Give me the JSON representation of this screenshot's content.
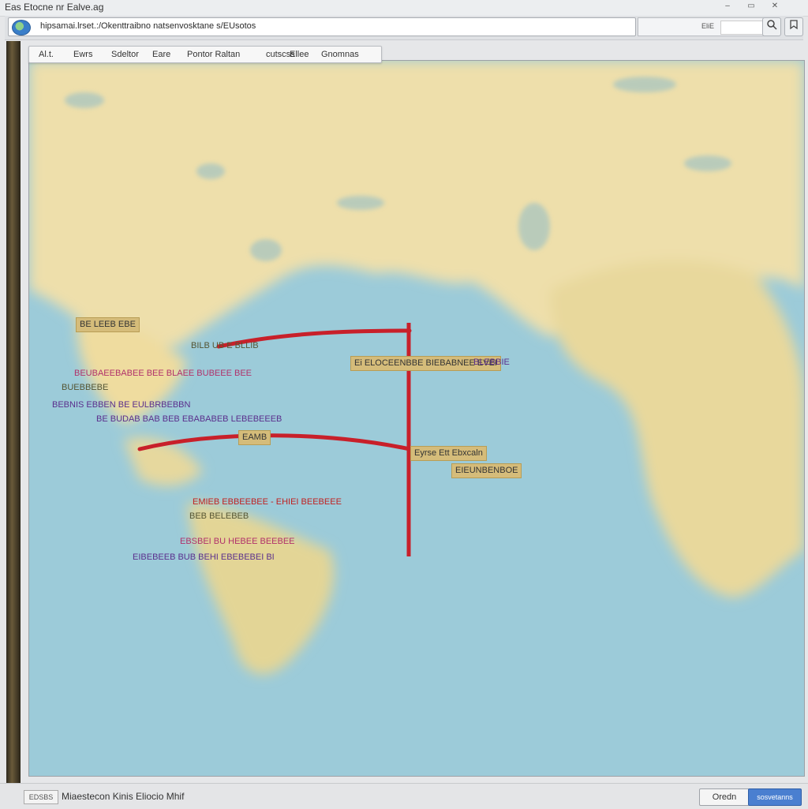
{
  "window": {
    "title": "Eas Etocne nr Ealve.ag",
    "controls": [
      "–",
      "▭",
      "✕"
    ]
  },
  "address": {
    "url": "hipsamai.lrset.:/Okenttraibno natsenvosktane s/EUsotos",
    "search_label": "EliE",
    "search_placeholder": "",
    "icons": [
      "globe-icon",
      "search-icon",
      "bookmark-icon"
    ]
  },
  "toolbar": {
    "items": [
      "Al.t.",
      "Ewrs",
      "Sdeltor",
      "Eare",
      "Pontor Raltan",
      "cutscss",
      "Ellee",
      "Gnomnas"
    ]
  },
  "map": {
    "colors": {
      "ocean": "#9ccbd9",
      "land": "#ead9a4",
      "route": "#c8202a"
    },
    "labels": [
      {
        "text": "BE LEEB EBE",
        "style": "tan"
      },
      {
        "text": "BILB UB E BLLIB",
        "style": "plain"
      },
      {
        "text": "BEUBAEEBABEE BEE BLAEE BUBEEE BEE",
        "style": "pink"
      },
      {
        "text": "BUEBBEBE",
        "style": "plain"
      },
      {
        "text": "BEBNIS EBBEN BE EULBRBEBBN",
        "style": "purple"
      },
      {
        "text": "BE BUDAB BAB BEB EBABABEB LEBEBEEEB",
        "style": "purple"
      },
      {
        "text": "EAMB",
        "style": "tan"
      },
      {
        "text": "Ei ELOCEENBBE BIEBABNEE EVEI",
        "style": "tan"
      },
      {
        "text": "BLEBBIE",
        "style": "purple"
      },
      {
        "text": "Eyrse Ett Ebxcaln",
        "style": "tan"
      },
      {
        "text": "EIEUNBENBOE",
        "style": "tan"
      },
      {
        "text": "EMIEB EBBEEBEE - EHIEI BEEBEEE",
        "style": "red"
      },
      {
        "text": "BEB BELEBEB",
        "style": "plain"
      },
      {
        "text": "EBSBEI BU HEBEE BEEBEE",
        "style": "pink"
      },
      {
        "text": "EIBEBEEB BUB BEHI EBEBEBEI BI",
        "style": "purple"
      }
    ]
  },
  "status": {
    "box": "EDSBS",
    "text": "Miaestecon Kinis Eliocio Mhif",
    "secondary_button": "Oredn",
    "primary_button": "sosvetanns"
  }
}
